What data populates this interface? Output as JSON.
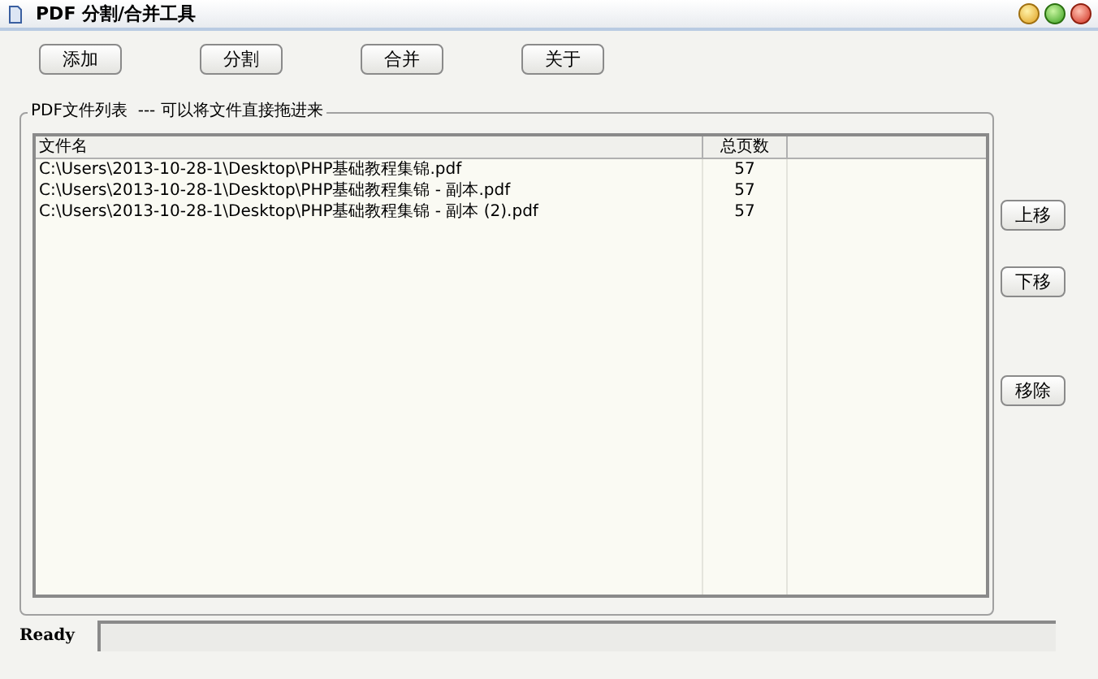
{
  "window": {
    "title": "PDF 分割/合并工具"
  },
  "toolbar": [
    "添加",
    "分割",
    "合并",
    "关于"
  ],
  "file_list": {
    "group_label": "PDF文件列表  --- 可以将文件直接拖进来",
    "columns": [
      "文件名",
      "总页数"
    ],
    "rows": [
      {
        "name": "C:\\Users\\2013-10-28-1\\Desktop\\PHP基础教程集锦.pdf",
        "pages": "57"
      },
      {
        "name": "C:\\Users\\2013-10-28-1\\Desktop\\PHP基础教程集锦 - 副本.pdf",
        "pages": "57"
      },
      {
        "name": "C:\\Users\\2013-10-28-1\\Desktop\\PHP基础教程集锦 - 副本 (2).pdf",
        "pages": "57"
      }
    ]
  },
  "side_buttons": [
    "上移",
    "下移",
    "移除"
  ],
  "status_bar": {
    "text": "Ready"
  }
}
